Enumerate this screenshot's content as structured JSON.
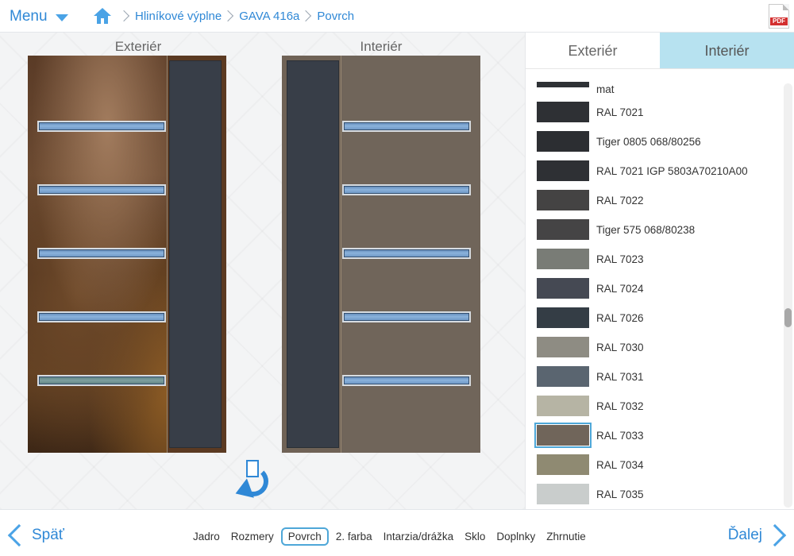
{
  "header": {
    "menu_label": "Menu",
    "breadcrumbs": [
      "Hliníkové výplne",
      "GAVA 416a",
      "Povrch"
    ],
    "pdf_label": "PDF"
  },
  "preview": {
    "exterior_label": "Exteriér",
    "interior_label": "Interiér"
  },
  "panel": {
    "tabs": [
      {
        "label": "Exteriér",
        "active": false
      },
      {
        "label": "Interiér",
        "active": true
      }
    ],
    "colors": [
      {
        "label": "mat",
        "color": "#2e3135"
      },
      {
        "label": "RAL 7021",
        "color": "#2e3034"
      },
      {
        "label": "Tiger 0805 068/80256",
        "color": "#2c2e32"
      },
      {
        "label": "RAL 7021 IGP 5803A70210A00",
        "color": "#2e3034"
      },
      {
        "label": "RAL 7022",
        "color": "#444343"
      },
      {
        "label": "Tiger 575 068/80238",
        "color": "#454445"
      },
      {
        "label": "RAL 7023",
        "color": "#797c76"
      },
      {
        "label": "RAL 7024",
        "color": "#454953"
      },
      {
        "label": "RAL 7026",
        "color": "#343d45"
      },
      {
        "label": "RAL 7030",
        "color": "#8e8c83"
      },
      {
        "label": "RAL 7031",
        "color": "#5a6570"
      },
      {
        "label": "RAL 7032",
        "color": "#b6b4a4"
      },
      {
        "label": "RAL 7033",
        "color": "#70655a"
      },
      {
        "label": "RAL 7034",
        "color": "#8f8a72"
      },
      {
        "label": "RAL 7035",
        "color": "#c9cdcc"
      }
    ],
    "selected_color": "RAL 7033"
  },
  "footer": {
    "back_label": "Späť",
    "next_label": "Ďalej",
    "steps": [
      "Jadro",
      "Rozmery",
      "Povrch",
      "2. farba",
      "Intarzia/drážka",
      "Sklo",
      "Doplnky",
      "Zhrnutie"
    ],
    "active_step": "Povrch"
  }
}
